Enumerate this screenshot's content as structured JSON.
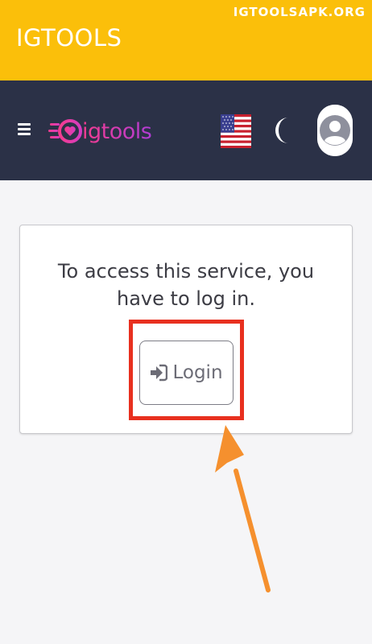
{
  "app": {
    "title": "IGTOOLS",
    "watermark": "IGTOOLSAPK.ORG"
  },
  "navbar": {
    "logo_text": "igtools",
    "menu_icon": "hamburger-icon",
    "language_icon": "us-flag-icon",
    "theme_icon": "moon-icon",
    "profile_icon": "user-avatar-icon"
  },
  "card": {
    "message": "To access this service, you have to log in.",
    "login_label": "Login",
    "login_icon": "sign-in-icon"
  },
  "colors": {
    "topbar": "#fbbf0a",
    "navbar": "#2b3147",
    "highlight": "#e8301f",
    "arrow": "#f5902e",
    "logo_gradient_start": "#f43c8e",
    "logo_gradient_end": "#b13cd6"
  }
}
